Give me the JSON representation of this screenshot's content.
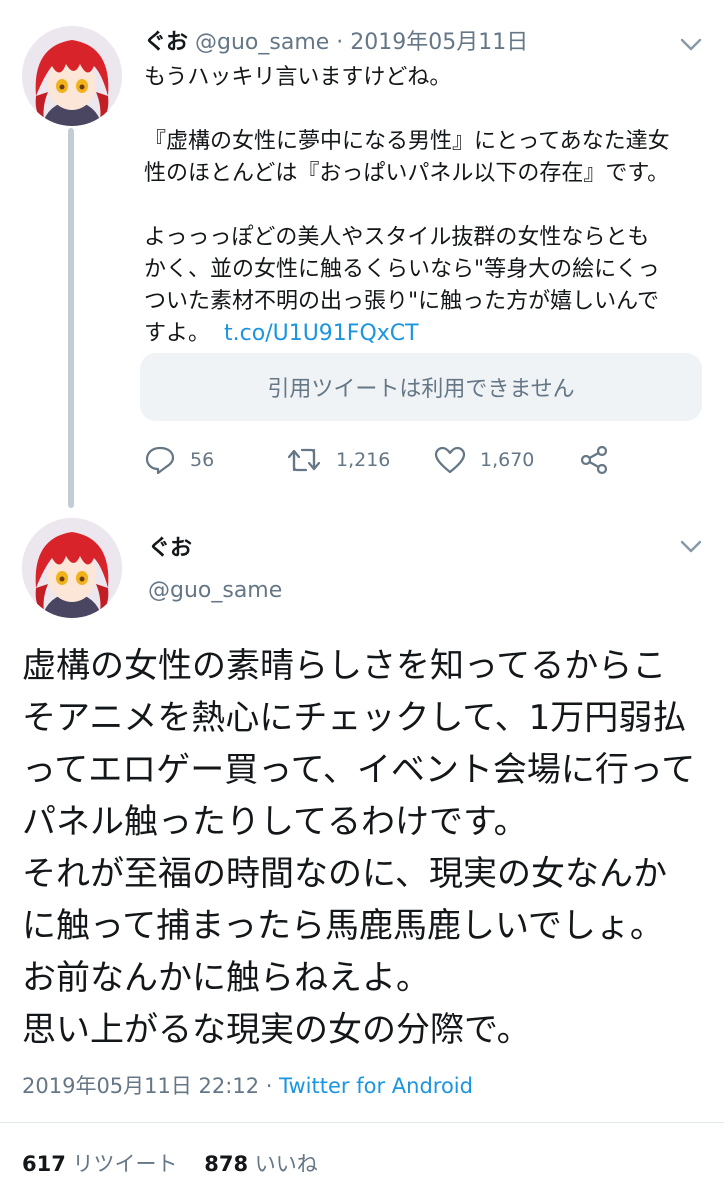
{
  "tweet1": {
    "display_name": "ぐお",
    "handle": "@guo_same",
    "separator": "·",
    "date": "2019年05月11日",
    "lines": [
      "もうハッキリ言いますけどね。",
      "",
      "『虚構の女性に夢中になる男性』にとってあなた達女",
      "性のほとんどは『おっぱいパネル以下の存在』です。",
      "",
      "よっっっぽどの美人やスタイル抜群の女性ならとも",
      "かく、並の女性に触るくらいなら\"等身大の絵にくっ",
      "ついた素材不明の出っ張り\"に触った方が嬉しいんで"
    ],
    "last_line_text": "すよ。",
    "link": "t.co/U1U91FQxCT",
    "quote_unavailable": "引用ツイートは利用できません",
    "replies": "56",
    "retweets": "1,216",
    "likes": "1,670"
  },
  "tweet2": {
    "display_name": "ぐお",
    "handle": "@guo_same",
    "lines": [
      "虚構の女性の素晴らしさを知ってるからこ",
      "そアニメを熱心にチェックして、1万円弱払",
      "ってエロゲー買って、イベント会場に行って",
      "パネル触ったりしてるわけです。",
      "それが至福の時間なのに、現実の女なんか",
      "に触って捕まったら馬鹿馬鹿しいでしょ。",
      "お前なんかに触らねえよ。",
      "思い上がるな現実の女の分際で。"
    ],
    "timestamp": "2019年05月11日 22:12",
    "separator": "·",
    "source": "Twitter for Android",
    "retweet_count": "617",
    "retweet_label": "リツイート",
    "like_count": "878",
    "like_label": "いいね"
  },
  "icons": {
    "chevron": "chevron-down-icon",
    "reply": "reply-icon",
    "retweet": "retweet-icon",
    "like": "heart-icon",
    "share": "share-icon"
  },
  "colors": {
    "link": "#1b95e0",
    "muted": "#657786",
    "text": "#14171a",
    "thread_line": "#c4cdd4",
    "quote_bg": "#f0f3f5"
  }
}
